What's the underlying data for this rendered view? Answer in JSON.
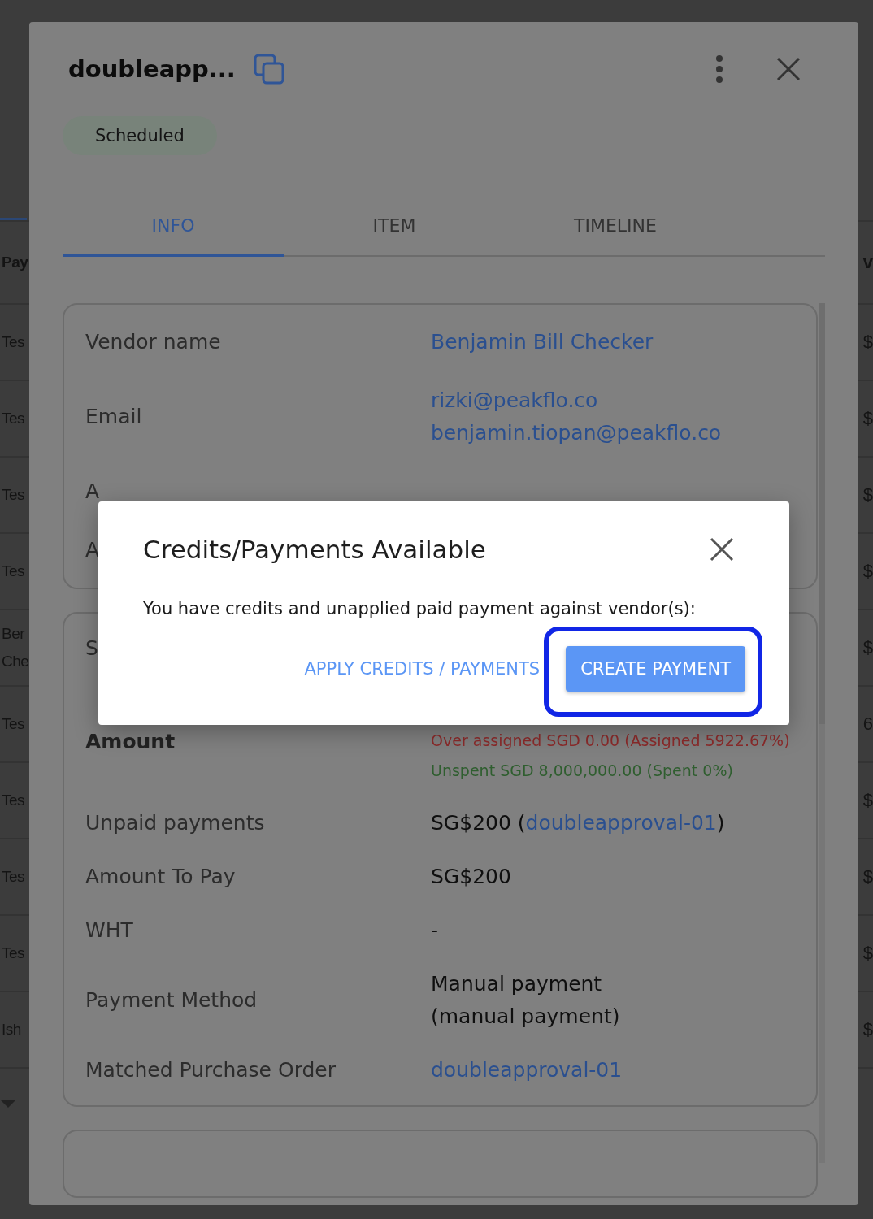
{
  "background_table": {
    "header": {
      "column_1": "Pay",
      "column_2": "v"
    },
    "rows": [
      {
        "column_1": "Tes",
        "column_2": "$"
      },
      {
        "column_1": "Tes",
        "column_2": "$"
      },
      {
        "column_1": "Tes",
        "column_2": "$"
      },
      {
        "column_1": "Tes",
        "column_2": "$"
      },
      {
        "column_1": "Ber Che",
        "column_2": "$"
      },
      {
        "column_1": "Tes",
        "column_2": "6"
      },
      {
        "column_1": "Tes",
        "column_2": "$"
      },
      {
        "column_1": "Tes",
        "column_2": "$"
      },
      {
        "column_1": "Tes",
        "column_2": "$"
      },
      {
        "column_1": "Ish",
        "column_2": "$"
      }
    ]
  },
  "drawer": {
    "title": "doubleapp...",
    "status": "Scheduled",
    "tabs": [
      {
        "label": "INFO",
        "selected": true
      },
      {
        "label": "ITEM",
        "selected": false
      },
      {
        "label": "TIMELINE",
        "selected": false
      }
    ],
    "cards": [
      {
        "rows": [
          {
            "label": "Vendor name",
            "values": [
              {
                "text": "Benjamin Bill Checker",
                "link": true
              }
            ]
          },
          {
            "label": "Email",
            "values": [
              {
                "text": "rizki@peakflo.co",
                "link": true
              },
              {
                "text": "benjamin.tiopan@peakflo.co",
                "link": true
              }
            ]
          },
          {
            "label": "A"
          },
          {
            "label": "A"
          }
        ]
      },
      {
        "rows": [
          {
            "label": "S"
          },
          {
            "label": "Amount",
            "bold": true,
            "values": [
              {
                "text": "Over assigned SGD 0.00 (Assigned 5922.67%)",
                "color": "#8c2b2b"
              },
              {
                "text": "Unspent SGD 8,000,000.00 (Spent 0%)",
                "color": "#2f5e2f"
              }
            ]
          },
          {
            "label": "Unpaid payments",
            "sentence": {
              "before": "SG$200 (",
              "link": "doubleapproval-01",
              "after": ")"
            }
          },
          {
            "label": "Amount To Pay",
            "values": [
              {
                "text": "SG$200"
              }
            ]
          },
          {
            "label": "WHT",
            "values": [
              {
                "text": "-"
              }
            ]
          },
          {
            "label": "Payment Method",
            "values": [
              {
                "text": "Manual payment"
              },
              {
                "text": "(manual payment)"
              }
            ]
          },
          {
            "label": "Matched Purchase Order",
            "values": [
              {
                "text": "doubleapproval-01",
                "link": true
              }
            ]
          }
        ]
      }
    ]
  },
  "dialog": {
    "title": "Credits/Payments Available",
    "message": "You have credits and unapplied paid payment against vendor(s):",
    "buttons": [
      {
        "label": "APPLY CREDITS / PAYMENTS",
        "kind": "text"
      },
      {
        "label": "CREATE PAYMENT",
        "kind": "contained",
        "highlighted": true
      }
    ]
  }
}
